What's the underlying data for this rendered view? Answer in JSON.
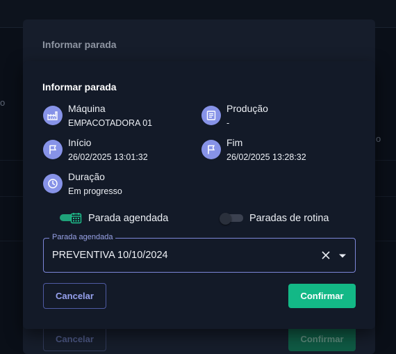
{
  "back_dialog": {
    "title": "Informar parada",
    "cancel_label": "Cancelar",
    "confirm_label": "Confirmar"
  },
  "background": {
    "left_edge_glyph": "o",
    "right_edge_glyph": "o"
  },
  "dialog": {
    "title": "Informar parada",
    "info": {
      "maquina": {
        "label": "Máquina",
        "value": "EMPACOTADORA 01",
        "icon": "factory-icon"
      },
      "producao": {
        "label": "Produção",
        "value": "-",
        "icon": "document-icon"
      },
      "inicio": {
        "label": "Início",
        "value": "26/02/2025 13:01:32",
        "icon": "flag-icon"
      },
      "fim": {
        "label": "Fim",
        "value": "26/02/2025 13:28:32",
        "icon": "flag-icon"
      },
      "duracao": {
        "label": "Duração",
        "value": "Em progresso",
        "icon": "clock-icon"
      }
    },
    "toggles": {
      "parada_agendada": {
        "label": "Parada agendada",
        "on": true
      },
      "paradas_rotina": {
        "label": "Paradas de rotina",
        "on": false
      }
    },
    "select": {
      "legend": "Parada agendada",
      "value": "PREVENTIVA 10/10/2024"
    },
    "buttons": {
      "cancel_label": "Cancelar",
      "confirm_label": "Confirmar"
    }
  },
  "colors": {
    "accent": "#8793e8",
    "confirm": "#13b886",
    "toggle_on": "#1fa27a"
  }
}
